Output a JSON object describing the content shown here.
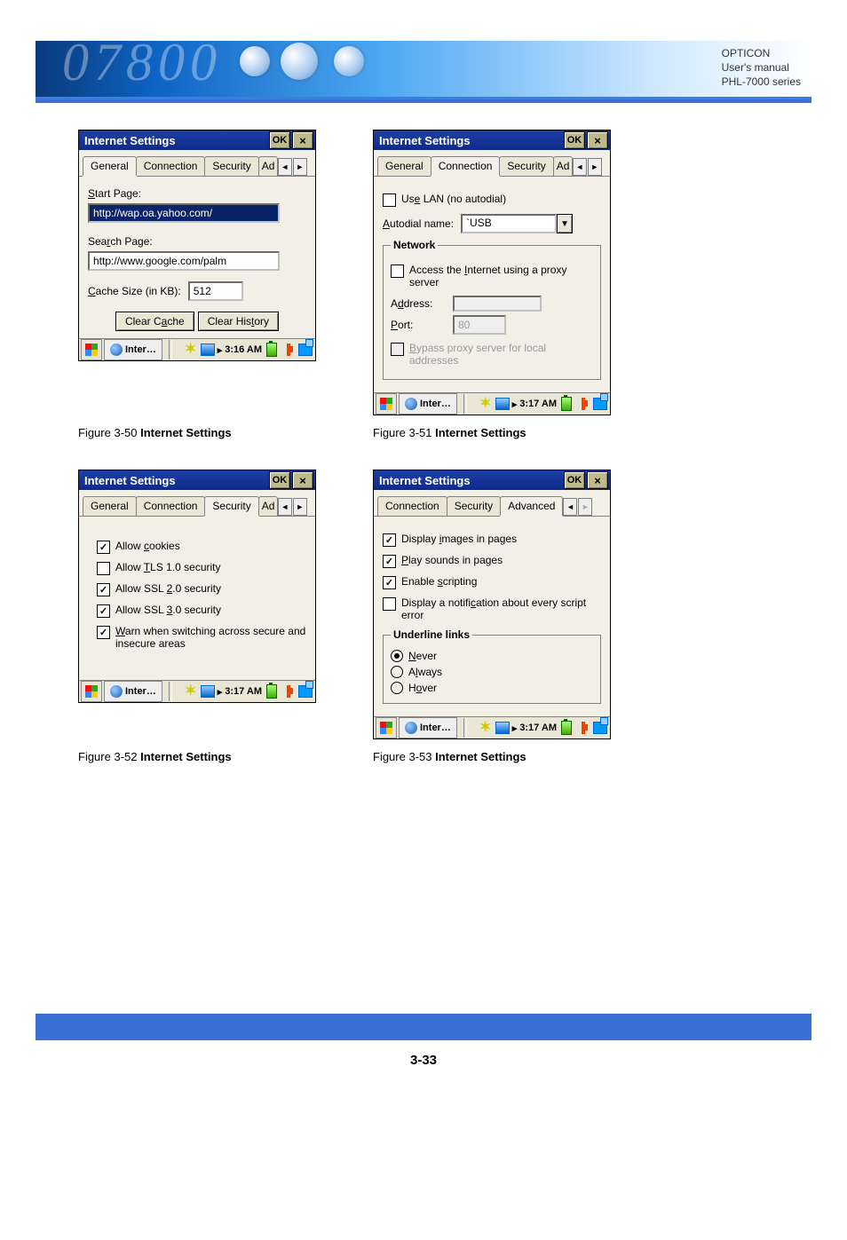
{
  "header": {
    "brand": "OPTICON",
    "line2": "User's manual",
    "line3": "PHL-7000 series",
    "watermark": "07800"
  },
  "window": {
    "title": "Internet Settings",
    "ok": "OK",
    "close": "×"
  },
  "tabs": {
    "general": "General",
    "connection": "Connection",
    "security": "Security",
    "advanced": "Advanced",
    "cut": "Ad"
  },
  "fig50": {
    "label_start": "Start Page:",
    "start_url": "http://wap.oa.yahoo.com/",
    "label_search": "Search Page:",
    "search_url": "http://www.google.com/palm",
    "label_cache": "Cache Size (in KB):",
    "cache_val": "512",
    "btn_clear_cache": "Clear Cache",
    "btn_clear_history": "Clear History",
    "caption_num": "Figure 3-50 ",
    "caption_bold": "Internet Settings",
    "taskbtn": "Inter…",
    "time": "3:16 AM"
  },
  "fig51": {
    "use_lan": "Use LAN (no autodial)",
    "autodial_lbl": "Autodial name:",
    "autodial_val": "`USB",
    "fs_title": "Network",
    "proxy": "Access the Internet using a proxy server",
    "addr_lbl": "Address:",
    "port_lbl": "Port:",
    "port_val": "80",
    "bypass": "Bypass proxy server for local addresses",
    "caption_num": "Figure 3-51 ",
    "caption_bold": "Internet Settings",
    "taskbtn": "Inter…",
    "time": "3:17 AM"
  },
  "fig52": {
    "allow_cookies": "Allow cookies",
    "allow_tls": "Allow TLS 1.0 security",
    "allow_ssl2": "Allow SSL 2.0 security",
    "allow_ssl3": "Allow SSL 3.0 security",
    "warn": "Warn when switching across secure and insecure areas",
    "caption_num": "Figure 3-52 ",
    "caption_bold": "Internet Settings",
    "taskbtn": "Inter…",
    "time": "3:17 AM"
  },
  "fig53": {
    "disp_images": "Display images in pages",
    "play_sounds": "Play sounds in pages",
    "enable_script": "Enable scripting",
    "notify": "Display a notification about every script error",
    "fs_title": "Underline links",
    "r_never": "Never",
    "r_always": "Always",
    "r_hover": "Hover",
    "caption_num": "Figure 3-53 ",
    "caption_bold": "Internet Settings",
    "taskbtn": "Inter…",
    "time": "3:17 AM"
  },
  "footer": {
    "page": "3-33"
  },
  "underline": {
    "S": "S",
    "r": "r",
    "C": "C",
    "a": "a",
    "t": "t",
    "e": "e",
    "A": "A",
    "I": "I",
    "d": "d",
    "P": "P",
    "B": "B",
    "c_lower": "c",
    "T_upper": "T",
    "two": "2",
    "three": "3",
    "W": "W",
    "i_lower": "i",
    "P_upper": "P",
    "s_lower": "s",
    "c2": "c",
    "N": "N",
    "l": "l",
    "o": "o"
  }
}
